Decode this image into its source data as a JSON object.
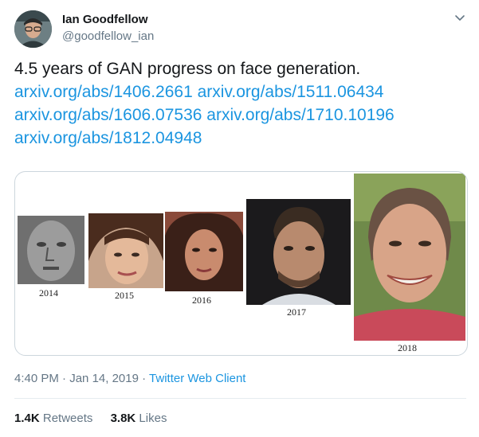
{
  "author": {
    "name": "Ian Goodfellow",
    "handle": "@goodfellow_ian"
  },
  "tweet": {
    "text": "4.5 years of GAN progress on face generation.",
    "links": [
      "arxiv.org/abs/1406.2661",
      "arxiv.org/abs/1511.06434",
      "arxiv.org/abs/1606.07536",
      "arxiv.org/abs/1710.10196",
      "arxiv.org/abs/1812.04948"
    ]
  },
  "media": {
    "years": [
      "2014",
      "2015",
      "2016",
      "2017",
      "2018"
    ]
  },
  "meta": {
    "time": "4:40 PM",
    "separator": "·",
    "date": "Jan 14, 2019",
    "client": "Twitter Web Client"
  },
  "stats": {
    "retweets_count": "1.4K",
    "retweets_label": "Retweets",
    "likes_count": "3.8K",
    "likes_label": "Likes"
  },
  "colors": {
    "link": "#1b95e0",
    "secondary_text": "#657786",
    "primary_text": "#14171a",
    "border": "#ccd6dd"
  },
  "icons": {
    "caret": "chevron-down-icon"
  }
}
